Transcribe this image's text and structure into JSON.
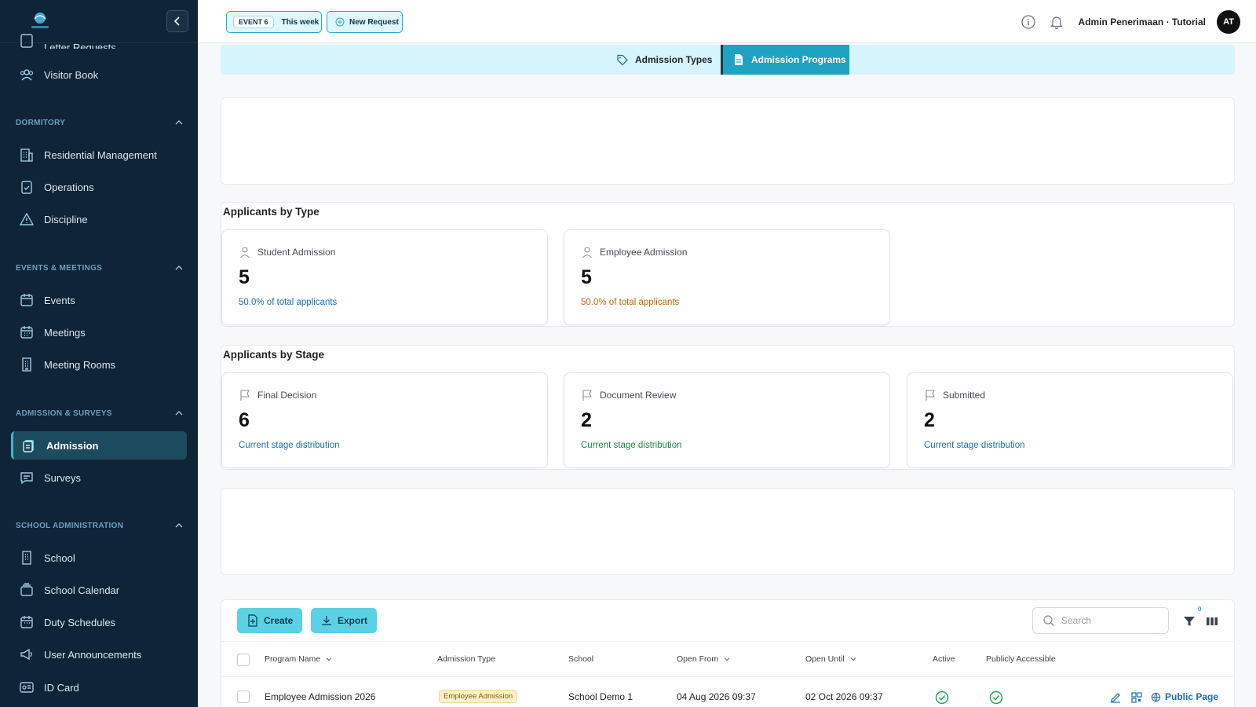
{
  "sidebar": {
    "partial_item": "Letter Requests",
    "visitor_book": "Visitor Book",
    "sections": {
      "dormitory": "DORMITORY",
      "events": "EVENTS & MEETINGS",
      "admission": "ADMISSION & SURVEYS",
      "school_admin": "SCHOOL ADMINISTRATION"
    },
    "items": {
      "residential": "Residential Management",
      "operations": "Operations",
      "discipline": "Discipline",
      "events": "Events",
      "meetings": "Meetings",
      "meeting_rooms": "Meeting Rooms",
      "admission": "Admission",
      "surveys": "Surveys",
      "school": "School",
      "school_calendar": "School Calendar",
      "duty_schedules": "Duty Schedules",
      "user_announcements": "User Announcements",
      "id_card": "ID Card"
    }
  },
  "header": {
    "event_badge": "EVENT 6",
    "event_label": "This week",
    "new_request": "New Request",
    "user_name": "Admin Penerimaan · Tutorial",
    "avatar_initials": "AT"
  },
  "tabs": {
    "types": "Admission Types",
    "programs": "Admission Programs"
  },
  "by_type": {
    "title": "Applicants by Type",
    "cards": [
      {
        "label": "Student Admission",
        "value": "5",
        "sub": "50.0% of total applicants",
        "sub_color": "#1a6fb0"
      },
      {
        "label": "Employee Admission",
        "value": "5",
        "sub": "50.0% of total applicants",
        "sub_color": "#c2660a"
      }
    ]
  },
  "by_stage": {
    "title": "Applicants by Stage",
    "cards": [
      {
        "label": "Final Decision",
        "value": "6",
        "sub": "Current stage distribution",
        "sub_color": "#1a6fb0"
      },
      {
        "label": "Document Review",
        "value": "2",
        "sub": "Current stage distribution",
        "sub_color": "#178a4c"
      },
      {
        "label": "Submitted",
        "value": "2",
        "sub": "Current stage distribution",
        "sub_color": "#1a6fb0"
      }
    ]
  },
  "table": {
    "create_label": "Create",
    "export_label": "Export",
    "search_placeholder": "Search",
    "filter_count": "0",
    "columns": {
      "program_name": "Program Name",
      "admission_type": "Admission Type",
      "school": "School",
      "open_from": "Open From",
      "open_until": "Open Until",
      "active": "Active",
      "public": "Publicly Accessible"
    },
    "rows": [
      {
        "program_name": "Employee Admission 2026",
        "admission_type": "Employee Admission",
        "school": "School Demo 1",
        "open_from": "04 Aug 2026 09:37",
        "open_until": "02 Oct 2026 09:37",
        "public_link": "Public Page"
      }
    ]
  },
  "colors": {
    "sidebar_bg": "#0f2436",
    "accent": "#1ea2c1",
    "button": "#5bd1e4",
    "success": "#17a35a"
  }
}
